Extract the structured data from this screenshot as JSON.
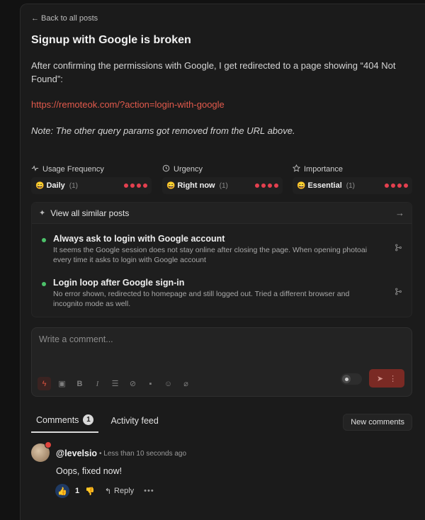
{
  "back_link": "← Back to all posts",
  "post": {
    "title": "Signup with Google is broken",
    "body": "After confirming the permissions with Google, I get redirected to a page showing “404 Not Found”:",
    "link": "https://remoteok.com/?action=login-with-google",
    "note": "Note: The other query params got removed from the URL above."
  },
  "metrics": [
    {
      "label": "Usage Frequency",
      "icon": "pulse-icon",
      "value": "Daily",
      "count": "(1)",
      "emoji": "😄",
      "level": 4
    },
    {
      "label": "Urgency",
      "icon": "clock-icon",
      "value": "Right now",
      "count": "(1)",
      "emoji": "😄",
      "level": 4
    },
    {
      "label": "Importance",
      "icon": "star-icon",
      "value": "Essential",
      "count": "(1)",
      "emoji": "😄",
      "level": 4
    }
  ],
  "similar": {
    "header": "View all similar posts",
    "items": [
      {
        "title": "Always ask to login with Google account",
        "desc": "It seems the Google session does not stay online after closing the page. When opening photoai every time it asks to login with Google account",
        "status_color": "#4cc26a"
      },
      {
        "title": "Login loop after Google sign-in",
        "desc": "No error shown, redirected to homepage and still logged out. Tried a different browser and incognito mode as well.",
        "status_color": "#4cc26a"
      }
    ]
  },
  "comment_box": {
    "placeholder": "Write a comment..."
  },
  "tabs": {
    "comments_label": "Comments",
    "comments_count": "1",
    "activity_label": "Activity feed",
    "new_comments": "New comments"
  },
  "comment": {
    "author": "@levelsio",
    "time": "• Less than 10 seconds ago",
    "text": "Oops, fixed now!",
    "likes": "1",
    "reply_label": "Reply"
  },
  "colors": {
    "accent": "#e35a4c",
    "dots": "#e4404f",
    "status_green": "#4cc26a"
  }
}
